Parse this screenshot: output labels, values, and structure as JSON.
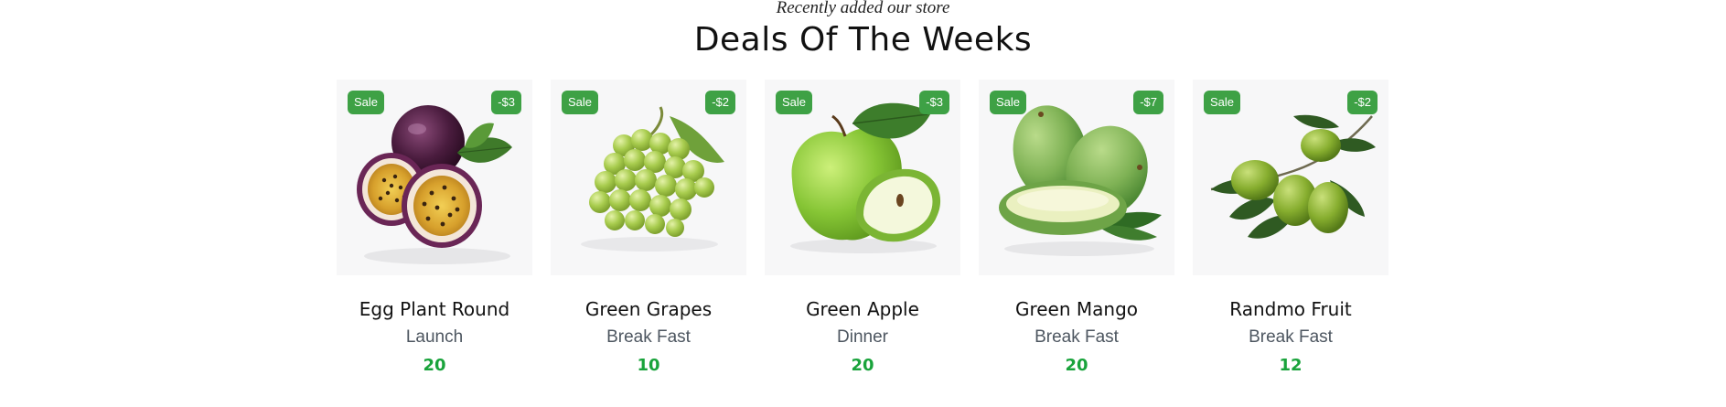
{
  "section": {
    "subtitle": "Recently added our store",
    "title": "Deals Of The Weeks"
  },
  "colors": {
    "badge": "#3ea145",
    "price": "#19a33b",
    "thumb_bg": "#f7f7f8"
  },
  "products": [
    {
      "image": "passion-fruit-image",
      "sale_label": "Sale",
      "discount": "-$3",
      "name": "Egg Plant Round",
      "category": "Launch",
      "price": "20"
    },
    {
      "image": "green-grapes-image",
      "sale_label": "Sale",
      "discount": "-$2",
      "name": "Green Grapes",
      "category": "Break Fast",
      "price": "10"
    },
    {
      "image": "green-apple-image",
      "sale_label": "Sale",
      "discount": "-$3",
      "name": "Green Apple",
      "category": "Dinner",
      "price": "20"
    },
    {
      "image": "green-mango-image",
      "sale_label": "Sale",
      "discount": "-$7",
      "name": "Green Mango",
      "category": "Break Fast",
      "price": "20"
    },
    {
      "image": "olive-branch-image",
      "sale_label": "Sale",
      "discount": "-$2",
      "name": "Randmo Fruit",
      "category": "Break Fast",
      "price": "12"
    }
  ]
}
